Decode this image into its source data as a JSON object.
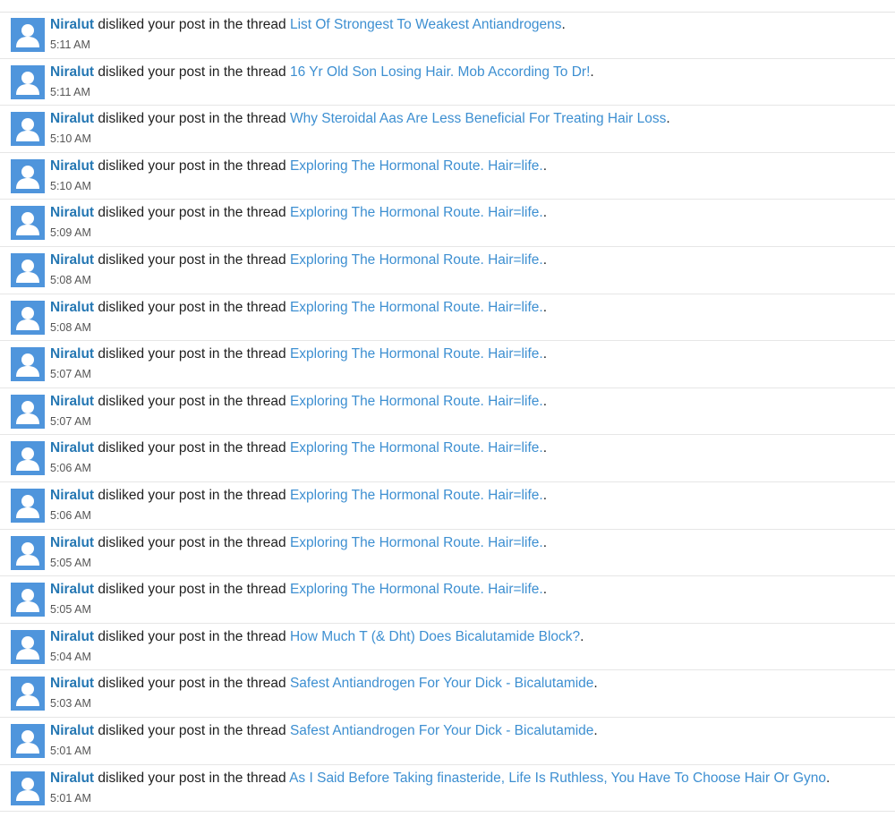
{
  "alerts": [
    {
      "user": "Niralut",
      "action": " disliked your post in the thread ",
      "thread": "List Of Strongest To Weakest Antiandrogens",
      "end": ".",
      "time": "5:11 AM"
    },
    {
      "user": "Niralut",
      "action": " disliked your post in the thread ",
      "thread": "16 Yr Old Son Losing Hair. Mob According To Dr!",
      "end": ".",
      "time": "5:11 AM"
    },
    {
      "user": "Niralut",
      "action": " disliked your post in the thread ",
      "thread": "Why Steroidal Aas Are Less Beneficial For Treating Hair Loss",
      "end": ".",
      "time": "5:10 AM"
    },
    {
      "user": "Niralut",
      "action": " disliked your post in the thread ",
      "thread": "Exploring The Hormonal Route. Hair=life.",
      "end": ".",
      "time": "5:10 AM"
    },
    {
      "user": "Niralut",
      "action": " disliked your post in the thread ",
      "thread": "Exploring The Hormonal Route. Hair=life.",
      "end": ".",
      "time": "5:09 AM"
    },
    {
      "user": "Niralut",
      "action": " disliked your post in the thread ",
      "thread": "Exploring The Hormonal Route. Hair=life.",
      "end": ".",
      "time": "5:08 AM"
    },
    {
      "user": "Niralut",
      "action": " disliked your post in the thread ",
      "thread": "Exploring The Hormonal Route. Hair=life.",
      "end": ".",
      "time": "5:08 AM"
    },
    {
      "user": "Niralut",
      "action": " disliked your post in the thread ",
      "thread": "Exploring The Hormonal Route. Hair=life.",
      "end": ".",
      "time": "5:07 AM"
    },
    {
      "user": "Niralut",
      "action": " disliked your post in the thread ",
      "thread": "Exploring The Hormonal Route. Hair=life.",
      "end": ".",
      "time": "5:07 AM"
    },
    {
      "user": "Niralut",
      "action": " disliked your post in the thread ",
      "thread": "Exploring The Hormonal Route. Hair=life.",
      "end": ".",
      "time": "5:06 AM"
    },
    {
      "user": "Niralut",
      "action": " disliked your post in the thread ",
      "thread": "Exploring The Hormonal Route. Hair=life.",
      "end": ".",
      "time": "5:06 AM"
    },
    {
      "user": "Niralut",
      "action": " disliked your post in the thread ",
      "thread": "Exploring The Hormonal Route. Hair=life.",
      "end": ".",
      "time": "5:05 AM"
    },
    {
      "user": "Niralut",
      "action": " disliked your post in the thread ",
      "thread": "Exploring The Hormonal Route. Hair=life.",
      "end": ".",
      "time": "5:05 AM"
    },
    {
      "user": "Niralut",
      "action": " disliked your post in the thread ",
      "thread": "How Much T (& Dht) Does Bicalutamide Block?",
      "end": ".",
      "time": "5:04 AM"
    },
    {
      "user": "Niralut",
      "action": " disliked your post in the thread ",
      "thread": "Safest Antiandrogen For Your Dick - Bicalutamide",
      "end": ".",
      "time": "5:03 AM"
    },
    {
      "user": "Niralut",
      "action": " disliked your post in the thread ",
      "thread": "Safest Antiandrogen For Your Dick - Bicalutamide",
      "end": ".",
      "time": "5:01 AM"
    },
    {
      "user": "Niralut",
      "action": " disliked your post in the thread ",
      "thread": "As I Said Before Taking finasteride, Life Is Ruthless, You Have To Choose Hair Or Gyno",
      "end": ".",
      "time": "5:01 AM"
    }
  ],
  "colors": {
    "avatar_bg": "#4f95dc",
    "username": "#2577b3",
    "thread_link": "#3d8fd1",
    "text": "#1f1f1f",
    "time": "#555555"
  },
  "icons": {
    "avatar": "default-user-avatar-icon"
  }
}
